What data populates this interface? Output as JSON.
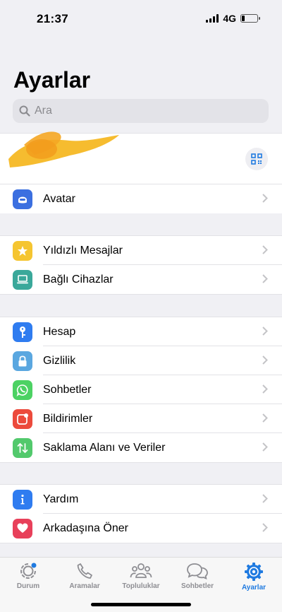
{
  "status": {
    "time": "21:37",
    "network": "4G"
  },
  "header": {
    "title": "Ayarlar"
  },
  "search": {
    "placeholder": "Ara"
  },
  "profile": {
    "qr_icon": "qr-code-icon"
  },
  "groups": [
    {
      "items": [
        {
          "label": "Avatar",
          "icon": "avatar-icon",
          "color": "#3b6fe0"
        }
      ]
    },
    {
      "items": [
        {
          "label": "Yıldızlı Mesajlar",
          "icon": "star-icon",
          "color": "#f5c531"
        },
        {
          "label": "Bağlı Cihazlar",
          "icon": "laptop-icon",
          "color": "#3aa89a"
        }
      ]
    },
    {
      "items": [
        {
          "label": "Hesap",
          "icon": "key-icon",
          "color": "#2f7cf0"
        },
        {
          "label": "Gizlilik",
          "icon": "lock-icon",
          "color": "#5aa7e0"
        },
        {
          "label": "Sohbetler",
          "icon": "whatsapp-icon",
          "color": "#4cd263"
        },
        {
          "label": "Bildirimler",
          "icon": "notification-icon",
          "color": "#ec4a3c"
        },
        {
          "label": "Saklama Alanı ve Veriler",
          "icon": "storage-arrows-icon",
          "color": "#52c96c"
        }
      ]
    },
    {
      "items": [
        {
          "label": "Yardım",
          "icon": "info-icon",
          "color": "#2f7cf0"
        },
        {
          "label": "Arkadaşına Öner",
          "icon": "heart-icon",
          "color": "#e8405a"
        }
      ]
    }
  ],
  "tabbar": {
    "tabs": [
      {
        "label": "Durum",
        "icon": "status-icon"
      },
      {
        "label": "Aramalar",
        "icon": "phone-icon"
      },
      {
        "label": "Topluluklar",
        "icon": "communities-icon"
      },
      {
        "label": "Sohbetler",
        "icon": "chats-icon"
      },
      {
        "label": "Ayarlar",
        "icon": "settings-gear-icon",
        "active": true
      }
    ],
    "active_color": "#1f7ae0",
    "inactive_color": "#8e8e93"
  }
}
